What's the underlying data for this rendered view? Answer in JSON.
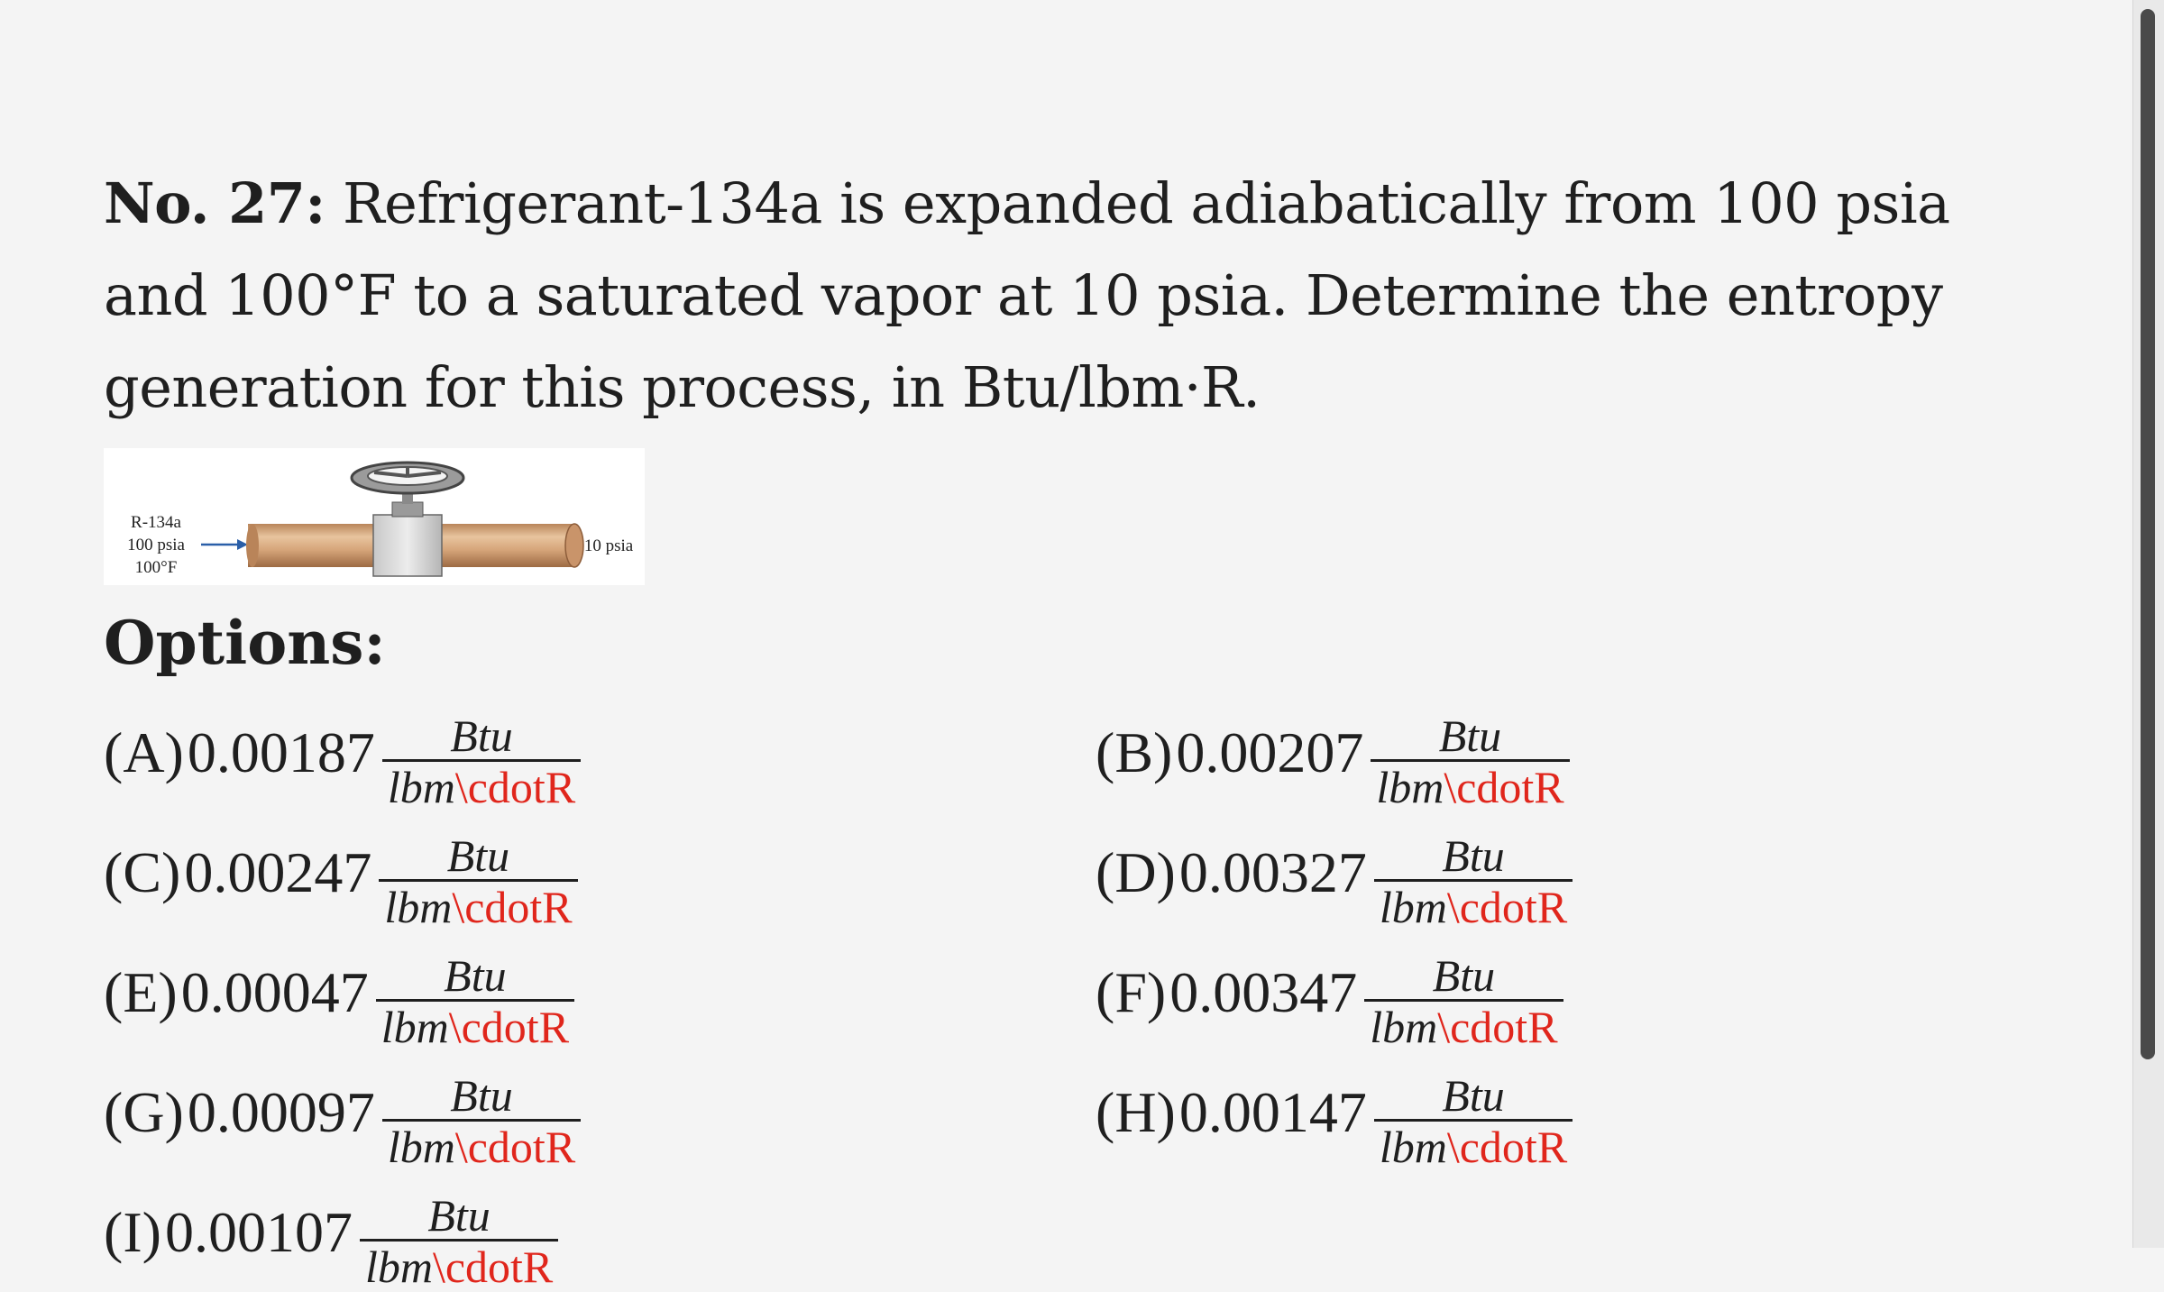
{
  "question": {
    "number_label": "No. 27:",
    "text": " Refrigerant-134a is expanded adiabatically from 100 psia and 100°F to a saturated vapor at 10 psia. Determine the entropy generation for this process, in Btu/lbm·R."
  },
  "figure": {
    "inlet_line1": "R-134a",
    "inlet_line2": "100 psia",
    "inlet_line3": "100°F",
    "outlet_label": "10 psia"
  },
  "options_heading": "Options:",
  "unit": {
    "numerator": "Btu",
    "denominator_unit": "lbm",
    "denominator_error": "\\cdotR"
  },
  "options": [
    {
      "letter": "(A)",
      "value": "0.00187"
    },
    {
      "letter": "(B)",
      "value": "0.00207"
    },
    {
      "letter": "(C)",
      "value": "0.00247"
    },
    {
      "letter": "(D)",
      "value": "0.00327"
    },
    {
      "letter": "(E)",
      "value": "0.00047"
    },
    {
      "letter": "(F)",
      "value": "0.00347"
    },
    {
      "letter": "(G)",
      "value": "0.00097"
    },
    {
      "letter": "(H)",
      "value": "0.00147"
    },
    {
      "letter": "(I)",
      "value": "0.00107"
    }
  ],
  "colors": {
    "background": "#f4f4f4",
    "text": "#1f1f1f",
    "error_text": "#e0261c",
    "pipe": "#d6a57a"
  }
}
